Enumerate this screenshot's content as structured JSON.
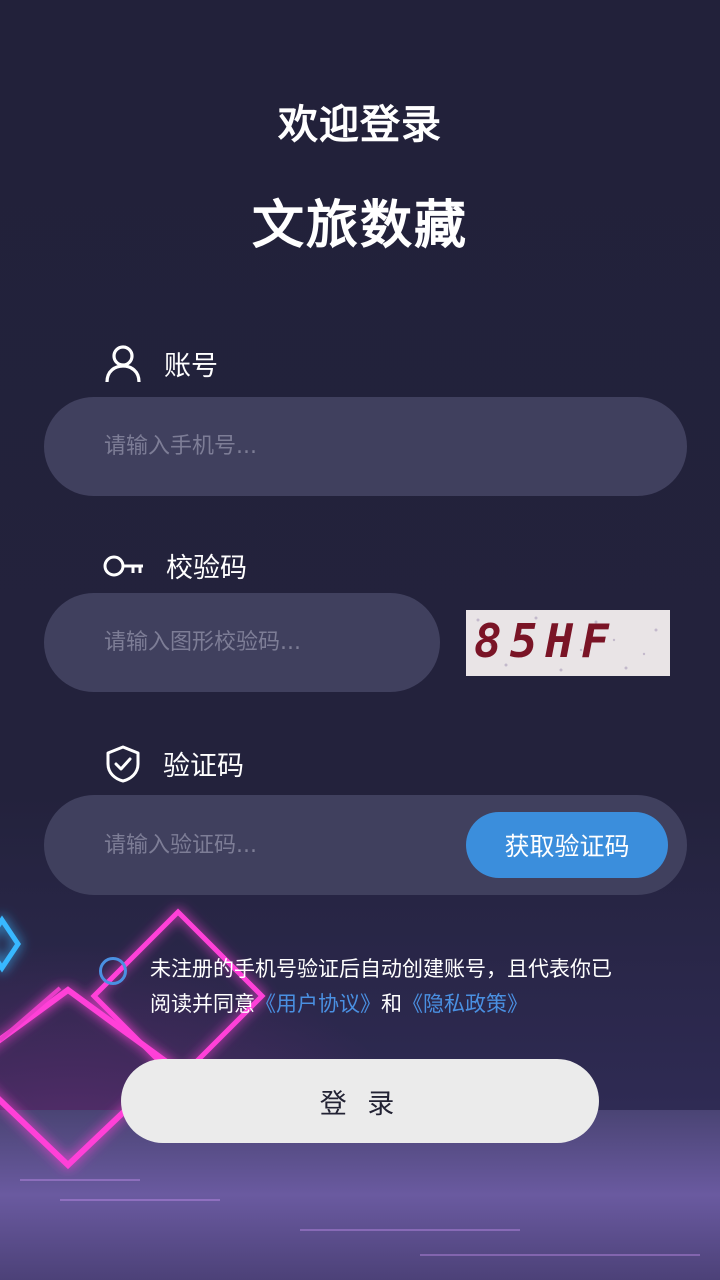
{
  "header": {
    "welcome": "欢迎登录",
    "app_name": "文旅数藏"
  },
  "account": {
    "label": "账号",
    "placeholder": "请输入手机号..."
  },
  "captcha": {
    "label": "校验码",
    "placeholder": "请输入图形校验码...",
    "image_text": "85HF"
  },
  "sms": {
    "label": "验证码",
    "placeholder": "请输入验证码...",
    "get_code_label": "获取验证码"
  },
  "agreement": {
    "text_prefix": "未注册的手机号验证后自动创建账号，且代表你已阅读并同意",
    "user_agreement": "《用户协议》",
    "connector": "和",
    "privacy_policy": "《隐私政策》",
    "checked": false
  },
  "login_button": "登 录",
  "icons": {
    "account": "user-icon",
    "captcha": "key-icon",
    "sms": "shield-check-icon"
  },
  "colors": {
    "background": "#21203a",
    "input_bg": "#40405e",
    "accent_blue": "#3b8edc",
    "link_blue": "#4a90e2",
    "login_bg": "#ebebeb"
  }
}
